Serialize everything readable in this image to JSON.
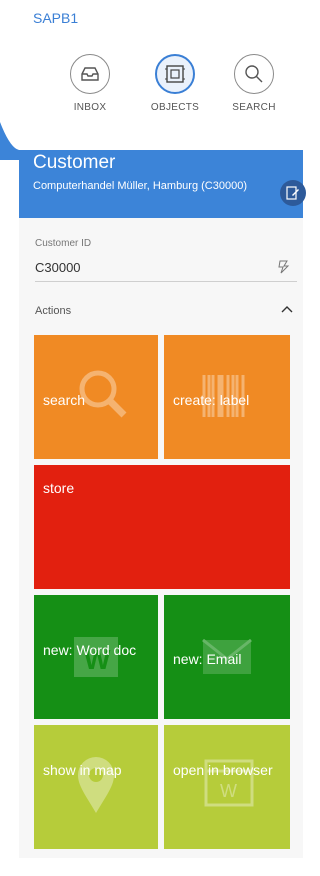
{
  "app": {
    "name": "SAPB1"
  },
  "nav": [
    {
      "label": "INBOX",
      "icon": "inbox-icon"
    },
    {
      "label": "OBJECTS",
      "icon": "objects-icon"
    },
    {
      "label": "SEARCH",
      "icon": "search-icon"
    }
  ],
  "header": {
    "title": "Customer",
    "subtitle": "Computerhandel Müller, Hamburg (C30000)"
  },
  "fields": {
    "customer_id_label": "Customer ID",
    "customer_id_value": "C30000"
  },
  "actions": {
    "label": "Actions",
    "tiles": [
      {
        "label": "search",
        "color": "#f08a24",
        "icon": "magnifier-icon"
      },
      {
        "label": "create: label",
        "color": "#f08a24",
        "icon": "barcode-icon"
      },
      {
        "label": "store",
        "color": "#e2200f",
        "icon": ""
      },
      {
        "label": "new: Word doc",
        "color": "#158f15",
        "icon": "word-icon"
      },
      {
        "label": "new: Email",
        "color": "#158f15",
        "icon": "envelope-icon"
      },
      {
        "label": "show in map",
        "color": "#b6cc3a",
        "icon": "map-pin-icon"
      },
      {
        "label": "open in browser",
        "color": "#b6cc3a",
        "icon": "browser-icon"
      }
    ]
  },
  "colors": {
    "accent": "#3c84d8"
  }
}
